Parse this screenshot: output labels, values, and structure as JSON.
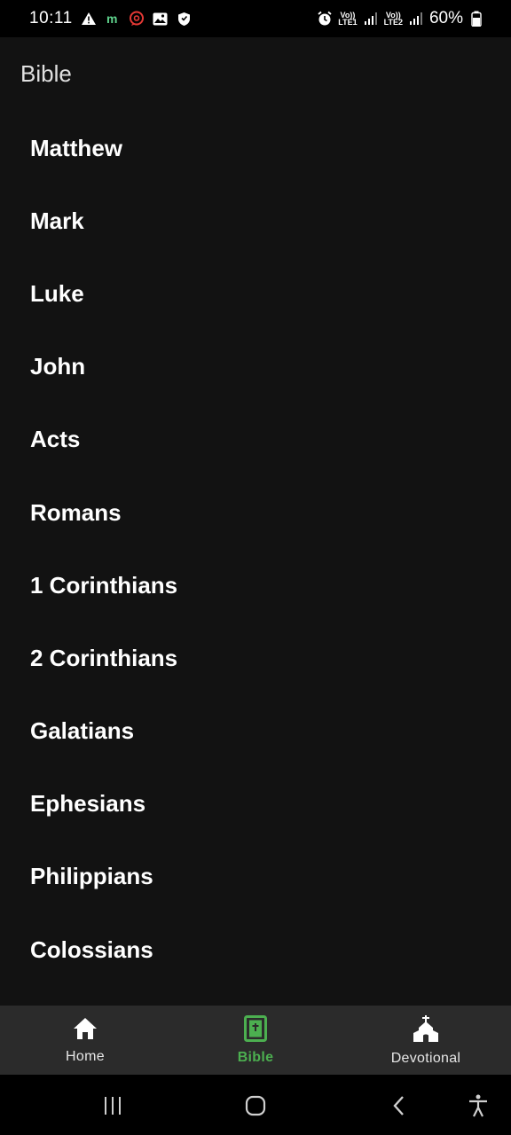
{
  "status_bar": {
    "time": "10:11",
    "net1": "Vo))\nLTE1",
    "net2": "Vo))\nLTE2",
    "battery": "60%",
    "icons": [
      "warning-icon",
      "m-app-icon",
      "at-chat-icon",
      "image-icon",
      "shield-icon",
      "alarm-icon",
      "signal-icon",
      "battery-icon"
    ]
  },
  "header": {
    "title": "Bible"
  },
  "books": [
    "Matthew",
    "Mark",
    "Luke",
    "John",
    "Acts",
    "Romans",
    "1 Corinthians",
    "2 Corinthians",
    "Galatians",
    "Ephesians",
    "Philippians",
    "Colossians"
  ],
  "bottom_nav": {
    "items": [
      {
        "label": "Home",
        "icon": "home-icon",
        "active": false
      },
      {
        "label": "Bible",
        "icon": "bible-icon",
        "active": true
      },
      {
        "label": "Devotional",
        "icon": "church-icon",
        "active": false
      }
    ]
  },
  "colors": {
    "background": "#121212",
    "accent": "#4caf50",
    "nav_bg": "#2b2b2b"
  }
}
